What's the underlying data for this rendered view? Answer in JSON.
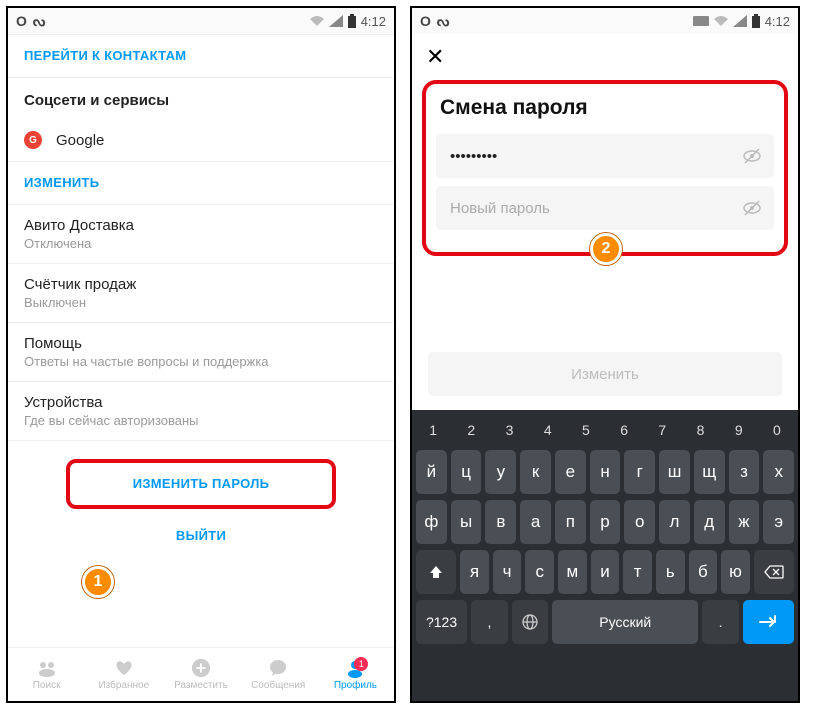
{
  "status": {
    "o": "O",
    "s": "ᔓ",
    "time": "4:12"
  },
  "p1": {
    "contacts_link": "ПЕРЕЙТИ К КОНТАКТАМ",
    "social_header": "Соцсети и сервисы",
    "google": "Google",
    "edit_link": "ИЗМЕНИТЬ",
    "items": [
      {
        "t": "Авито Доставка",
        "s": "Отключена"
      },
      {
        "t": "Счётчик продаж",
        "s": "Выключен"
      },
      {
        "t": "Помощь",
        "s": "Ответы на частые вопросы и поддержка"
      },
      {
        "t": "Устройства",
        "s": "Где вы сейчас авторизованы"
      }
    ],
    "change_pwd": "ИЗМЕНИТЬ ПАРОЛЬ",
    "logout": "ВЫЙТИ",
    "nav": [
      "Поиск",
      "Избранное",
      "Разместить",
      "Сообщения",
      "Профиль"
    ],
    "badge": "1"
  },
  "p2": {
    "title": "Смена пароля",
    "pwd_value": "•••••••••",
    "new_placeholder": "Новый пароль",
    "action": "Изменить",
    "numrow": [
      "1",
      "2",
      "3",
      "4",
      "5",
      "6",
      "7",
      "8",
      "9",
      "0"
    ],
    "row1": [
      "й",
      "ц",
      "у",
      "к",
      "е",
      "н",
      "г",
      "ш",
      "щ",
      "з",
      "х"
    ],
    "row2": [
      "ф",
      "ы",
      "в",
      "а",
      "п",
      "р",
      "о",
      "л",
      "д",
      "ж",
      "э"
    ],
    "row3": [
      "я",
      "ч",
      "с",
      "м",
      "и",
      "т",
      "ь",
      "б",
      "ю"
    ],
    "sym": "?123",
    "lang": "Русский"
  },
  "callouts": {
    "one": "1",
    "two": "2"
  }
}
